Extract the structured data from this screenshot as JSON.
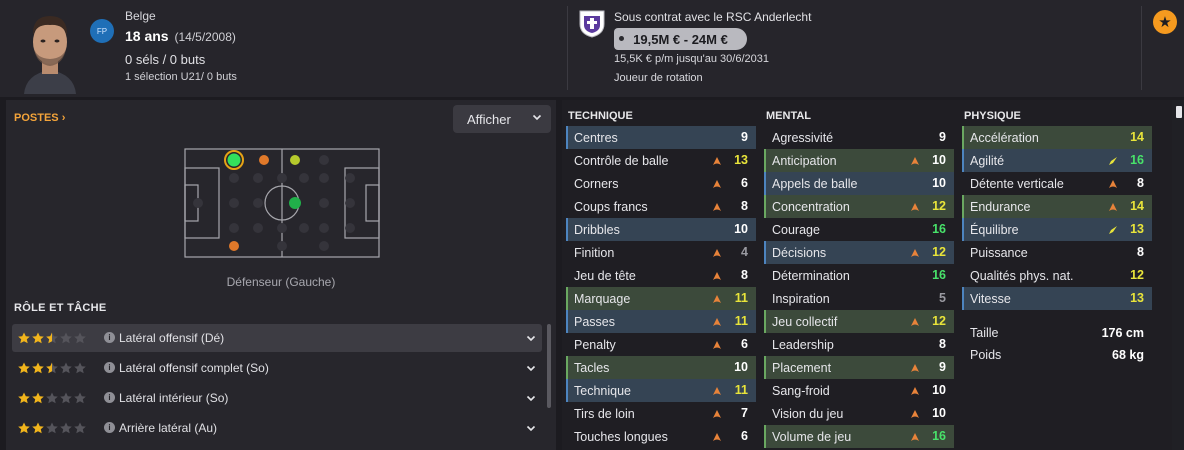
{
  "header": {
    "position_badge": "FP",
    "nationality": "Belge",
    "age": "18 ans",
    "dob": "(14/5/2008)",
    "caps": "0 séls / 0 buts",
    "u21": "1 sélection U21/ 0 buts",
    "contract": "Sous contrat avec le RSC Anderlecht",
    "value": "19,5M € - 24M €",
    "wage": "15,5K € p/m jusqu'au 30/6/2031",
    "squad_status": "Joueur de rotation",
    "favorite_icon": "star-icon"
  },
  "positions": {
    "title": "POSTES",
    "show_button": "Afficher",
    "role_caption": "Défenseur (Gauche)"
  },
  "roles": {
    "title": "RÔLE ET TÂCHE",
    "items": [
      {
        "label": "Latéral offensif (Dé)",
        "stars": 2.5,
        "active": true
      },
      {
        "label": "Latéral offensif complet (So)",
        "stars": 2.5,
        "active": false
      },
      {
        "label": "Latéral intérieur (So)",
        "stars": 2,
        "active": false
      },
      {
        "label": "Arrière latéral (Au)",
        "stars": 2,
        "active": false
      }
    ]
  },
  "technique": {
    "title": "TECHNIQUE",
    "rows": [
      {
        "label": "Centres",
        "value": "9",
        "color": "white",
        "hl": "blue",
        "arrow": ""
      },
      {
        "label": "Contrôle de balle",
        "value": "13",
        "color": "yellow",
        "hl": "",
        "arrow": "up-orange"
      },
      {
        "label": "Corners",
        "value": "6",
        "color": "white",
        "hl": "",
        "arrow": "up-orange"
      },
      {
        "label": "Coups francs",
        "value": "8",
        "color": "white",
        "hl": "",
        "arrow": "up-orange"
      },
      {
        "label": "Dribbles",
        "value": "10",
        "color": "white",
        "hl": "blue",
        "arrow": ""
      },
      {
        "label": "Finition",
        "value": "4",
        "color": "grey",
        "hl": "",
        "arrow": "up-orange"
      },
      {
        "label": "Jeu de tête",
        "value": "8",
        "color": "white",
        "hl": "",
        "arrow": "up-orange"
      },
      {
        "label": "Marquage",
        "value": "11",
        "color": "yellow",
        "hl": "green",
        "arrow": "up-orange"
      },
      {
        "label": "Passes",
        "value": "11",
        "color": "yellow",
        "hl": "blue",
        "arrow": "up-orange"
      },
      {
        "label": "Penalty",
        "value": "6",
        "color": "white",
        "hl": "",
        "arrow": "up-orange"
      },
      {
        "label": "Tacles",
        "value": "10",
        "color": "white",
        "hl": "green",
        "arrow": ""
      },
      {
        "label": "Technique",
        "value": "11",
        "color": "yellow",
        "hl": "blue",
        "arrow": "up-orange"
      },
      {
        "label": "Tirs de loin",
        "value": "7",
        "color": "white",
        "hl": "",
        "arrow": "up-orange"
      },
      {
        "label": "Touches longues",
        "value": "6",
        "color": "white",
        "hl": "",
        "arrow": "up-orange"
      }
    ]
  },
  "mental": {
    "title": "MENTAL",
    "rows": [
      {
        "label": "Agressivité",
        "value": "9",
        "color": "white",
        "hl": "",
        "arrow": ""
      },
      {
        "label": "Anticipation",
        "value": "10",
        "color": "white",
        "hl": "green",
        "arrow": "up-orange"
      },
      {
        "label": "Appels de balle",
        "value": "10",
        "color": "white",
        "hl": "blue",
        "arrow": ""
      },
      {
        "label": "Concentration",
        "value": "12",
        "color": "yellow",
        "hl": "green",
        "arrow": "up-orange"
      },
      {
        "label": "Courage",
        "value": "16",
        "color": "green",
        "hl": "",
        "arrow": ""
      },
      {
        "label": "Décisions",
        "value": "12",
        "color": "yellow",
        "hl": "blue",
        "arrow": "up-orange"
      },
      {
        "label": "Détermination",
        "value": "16",
        "color": "green",
        "hl": "",
        "arrow": ""
      },
      {
        "label": "Inspiration",
        "value": "5",
        "color": "grey",
        "hl": "",
        "arrow": ""
      },
      {
        "label": "Jeu collectif",
        "value": "12",
        "color": "yellow",
        "hl": "green",
        "arrow": "up-orange"
      },
      {
        "label": "Leadership",
        "value": "8",
        "color": "white",
        "hl": "",
        "arrow": ""
      },
      {
        "label": "Placement",
        "value": "9",
        "color": "white",
        "hl": "green",
        "arrow": "up-orange"
      },
      {
        "label": "Sang-froid",
        "value": "10",
        "color": "white",
        "hl": "",
        "arrow": "up-orange"
      },
      {
        "label": "Vision du jeu",
        "value": "10",
        "color": "white",
        "hl": "",
        "arrow": "up-orange"
      },
      {
        "label": "Volume de jeu",
        "value": "16",
        "color": "green",
        "hl": "green",
        "arrow": "up-orange"
      }
    ]
  },
  "physique": {
    "title": "PHYSIQUE",
    "rows": [
      {
        "label": "Accélération",
        "value": "14",
        "color": "yellow",
        "hl": "green",
        "arrow": ""
      },
      {
        "label": "Agilité",
        "value": "16",
        "color": "green",
        "hl": "blue",
        "arrow": "up-yellow"
      },
      {
        "label": "Détente verticale",
        "value": "8",
        "color": "white",
        "hl": "",
        "arrow": "up-orange"
      },
      {
        "label": "Endurance",
        "value": "14",
        "color": "yellow",
        "hl": "green",
        "arrow": "up-orange"
      },
      {
        "label": "Équilibre",
        "value": "13",
        "color": "yellow",
        "hl": "blue",
        "arrow": "up-yellow"
      },
      {
        "label": "Puissance",
        "value": "8",
        "color": "white",
        "hl": "",
        "arrow": ""
      },
      {
        "label": "Qualités phys. nat.",
        "value": "12",
        "color": "yellow",
        "hl": "",
        "arrow": ""
      },
      {
        "label": "Vitesse",
        "value": "13",
        "color": "yellow",
        "hl": "blue",
        "arrow": ""
      }
    ],
    "height_label": "Taille",
    "height_value": "176 cm",
    "weight_label": "Poids",
    "weight_value": "68 kg"
  }
}
